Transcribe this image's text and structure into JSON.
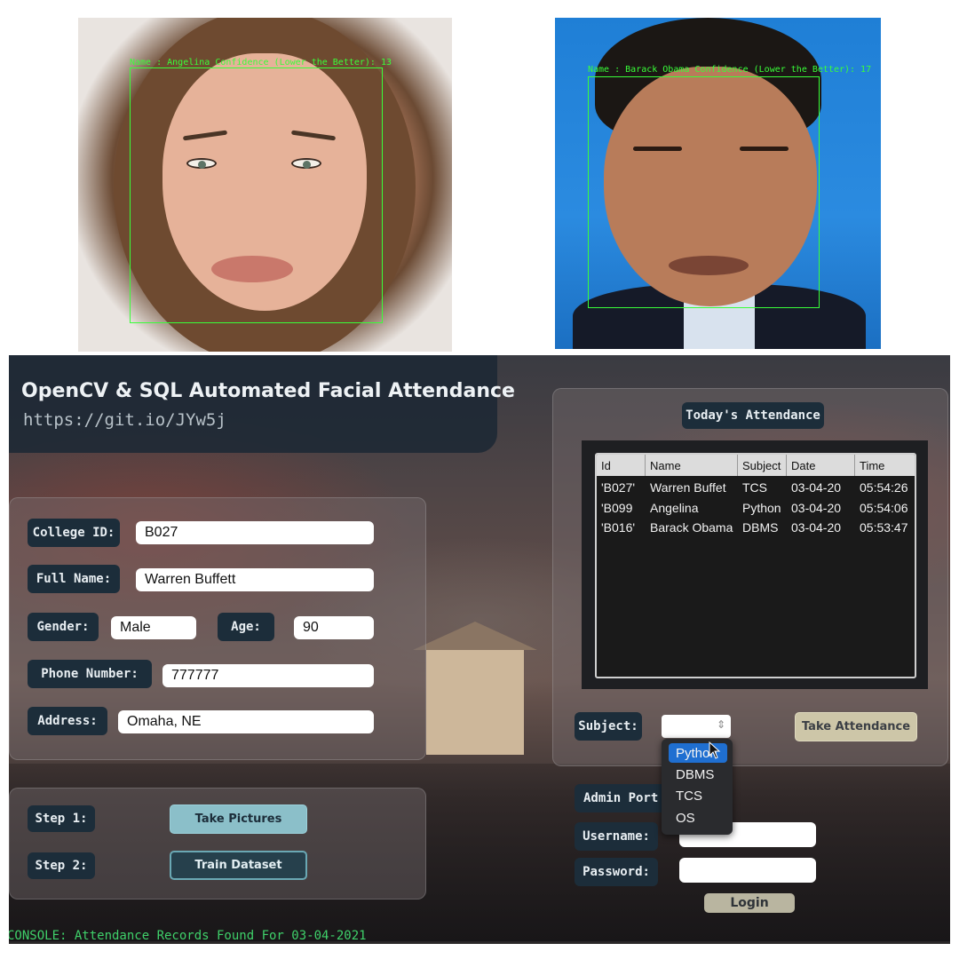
{
  "photos": {
    "left": {
      "label": "Name : Angelina Confidence (Lower the Better):  13"
    },
    "right": {
      "label": "Name : Barack Obama Confidence (Lower the Better):  17"
    }
  },
  "app": {
    "title": "OpenCV & SQL  Automated Facial Attendance",
    "url": "https://git.io/JYw5j",
    "form": {
      "college_id_label": "College ID:",
      "college_id_value": "B027",
      "full_name_label": "Full Name:",
      "full_name_value": "Warren Buffett",
      "gender_label": "Gender:",
      "gender_value": "Male",
      "age_label": "Age:",
      "age_value": "90",
      "phone_label": "Phone Number:",
      "phone_value": "777777",
      "address_label": "Address:",
      "address_value": "Omaha, NE"
    },
    "steps": {
      "step1_label": "Step 1:",
      "step1_button": "Take Pictures",
      "step2_label": "Step 2:",
      "step2_button": "Train Dataset"
    },
    "attendance": {
      "title": "Today's Attendance",
      "columns": [
        "Id",
        "Name",
        "Subject",
        "Date",
        "Time"
      ],
      "rows": [
        [
          "'B027'",
          "Warren Buffet",
          "TCS",
          "03-04-20",
          "05:54:26"
        ],
        [
          "'B099",
          "Angelina",
          "Python",
          "03-04-20",
          "05:54:06"
        ],
        [
          "'B016'",
          "Barack Obama",
          "DBMS",
          "03-04-20",
          "05:53:47"
        ]
      ],
      "subject_label": "Subject:",
      "take_attendance_button": "Take Attendance",
      "subject_options": [
        "Python",
        "DBMS",
        "TCS",
        "OS"
      ],
      "selected_option": "Python"
    },
    "admin": {
      "title": "Admin Port",
      "username_label": "Username:",
      "password_label": "Password:",
      "login_button": "Login"
    },
    "console": "CONSOLE: Attendance Records Found For 03-04-2021"
  },
  "colors": {
    "detection_box": "#39ff39",
    "console_text": "#3fd06a",
    "dropdown_selected": "#1f6fd1",
    "tag_bg": "#1c2d3a"
  }
}
